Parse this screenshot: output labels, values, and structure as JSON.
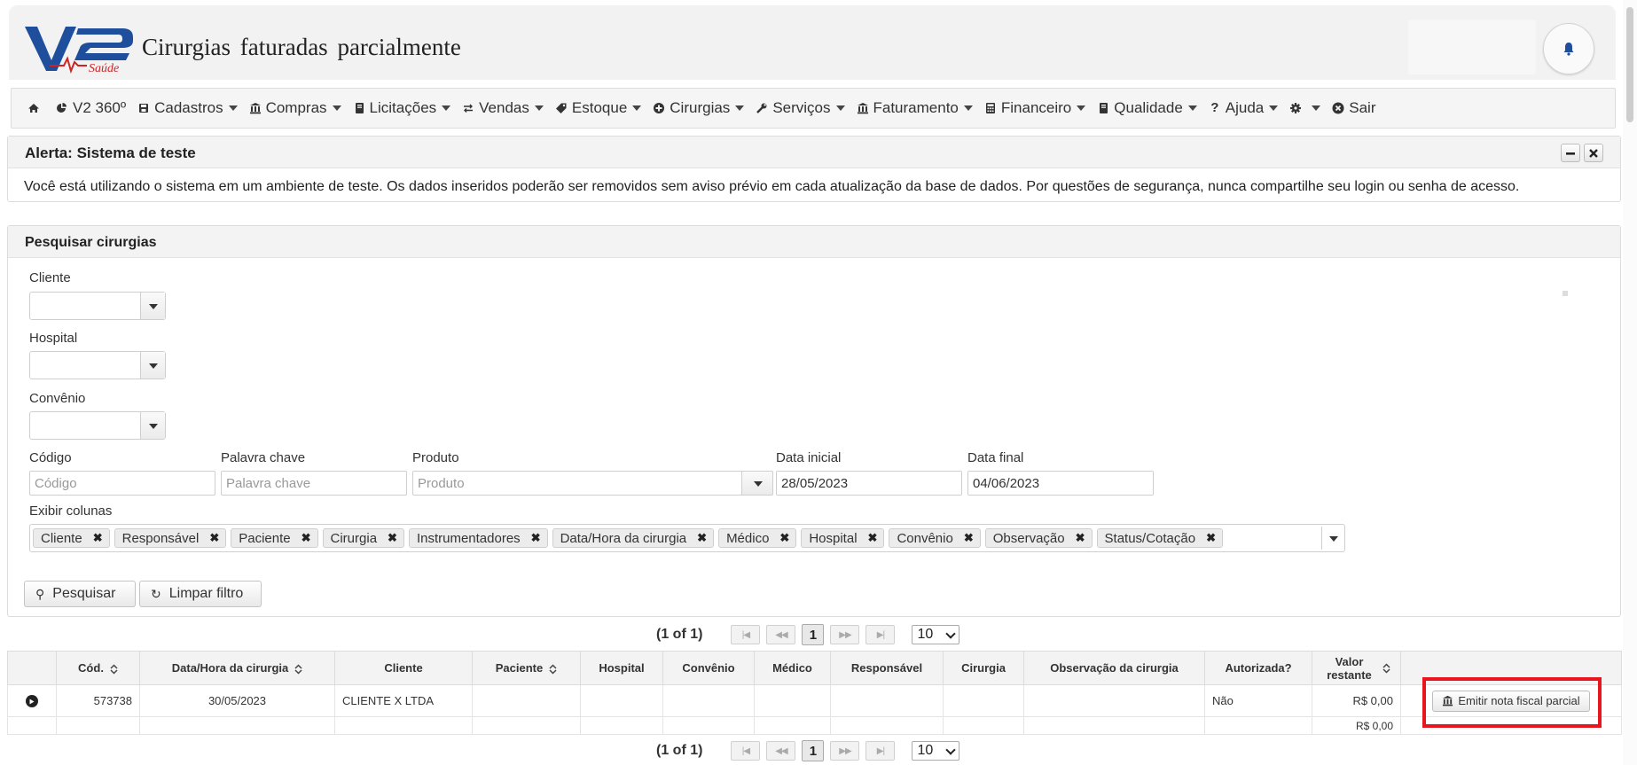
{
  "header": {
    "title": "Cirurgias faturadas parcialmente",
    "logo_text": "V2 Saúde",
    "brand_color": "#1f4e9c",
    "accent_color": "#d32020"
  },
  "menu": {
    "items": [
      {
        "label": "",
        "icon": "home-icon",
        "has_caret": false
      },
      {
        "label": "V2 360º",
        "icon": "pie-chart-icon",
        "has_caret": false
      },
      {
        "label": "Cadastros",
        "icon": "save-icon",
        "has_caret": true
      },
      {
        "label": "Compras",
        "icon": "bank-icon",
        "has_caret": true
      },
      {
        "label": "Licitações",
        "icon": "book-icon",
        "has_caret": true
      },
      {
        "label": "Vendas",
        "icon": "exchange-icon",
        "has_caret": true
      },
      {
        "label": "Estoque",
        "icon": "tag-icon",
        "has_caret": true
      },
      {
        "label": "Cirurgias",
        "icon": "plus-circle-icon",
        "has_caret": true
      },
      {
        "label": "Serviços",
        "icon": "wrench-icon",
        "has_caret": true
      },
      {
        "label": "Faturamento",
        "icon": "bank-icon",
        "has_caret": true
      },
      {
        "label": "Financeiro",
        "icon": "calculator-icon",
        "has_caret": true
      },
      {
        "label": "Qualidade",
        "icon": "book-icon",
        "has_caret": true
      },
      {
        "label": "Ajuda",
        "icon": "question-icon",
        "has_caret": true
      },
      {
        "label": "",
        "icon": "gear-icon",
        "has_caret": true
      },
      {
        "label": "Sair",
        "icon": "close-circle-icon",
        "has_caret": false
      }
    ]
  },
  "alert": {
    "title": "Alerta: Sistema de teste",
    "message": "Você está utilizando o sistema em um ambiente de teste. Os dados inseridos poderão ser removidos sem aviso prévio em cada atualização da base de dados. Por questões de segurança, nunca compartilhe seu login ou senha de acesso."
  },
  "search": {
    "title": "Pesquisar cirurgias",
    "cliente_label": "Cliente",
    "hospital_label": "Hospital",
    "convenio_label": "Convênio",
    "codigo": {
      "label": "Código",
      "value": "",
      "placeholder": "Código"
    },
    "palavra": {
      "label": "Palavra chave",
      "value": "",
      "placeholder": "Palavra chave"
    },
    "produto": {
      "label": "Produto",
      "value": "",
      "placeholder": "Produto"
    },
    "data_inicial": {
      "label": "Data inicial",
      "value": "28/05/2023"
    },
    "data_final": {
      "label": "Data final",
      "value": "04/06/2023"
    },
    "columns_label": "Exibir colunas",
    "columns": [
      "Cliente",
      "Responsável",
      "Paciente",
      "Cirurgia",
      "Instrumentadores",
      "Data/Hora da cirurgia",
      "Médico",
      "Hospital",
      "Convênio",
      "Observação",
      "Status/Cotação"
    ],
    "search_button": "Pesquisar",
    "clear_button": "Limpar filtro"
  },
  "paginator": {
    "count": "(1 of 1)",
    "first": "|◀",
    "prev": "◀◀",
    "page": "1",
    "next": "▶▶",
    "last": "▶|",
    "rows": "10"
  },
  "table": {
    "headers": [
      "Cód.",
      "Data/Hora da cirurgia",
      "Cliente",
      "Paciente",
      "Hospital",
      "Convênio",
      "Médico",
      "Responsável",
      "Cirurgia",
      "Observação da cirurgia",
      "Autorizada?",
      "Valor restante"
    ],
    "rows": [
      {
        "codigo": "573738",
        "data": "30/05/2023",
        "cliente": "CLIENTE X LTDA",
        "paciente": "",
        "hospital": "",
        "convenio": "",
        "medico": "",
        "responsavel": "",
        "cirurgia": "",
        "observacao": "",
        "autorizada": "Não",
        "valor": "R$ 0,00",
        "action": "Emitir nota fiscal parcial"
      }
    ],
    "total": "R$ 0,00"
  }
}
